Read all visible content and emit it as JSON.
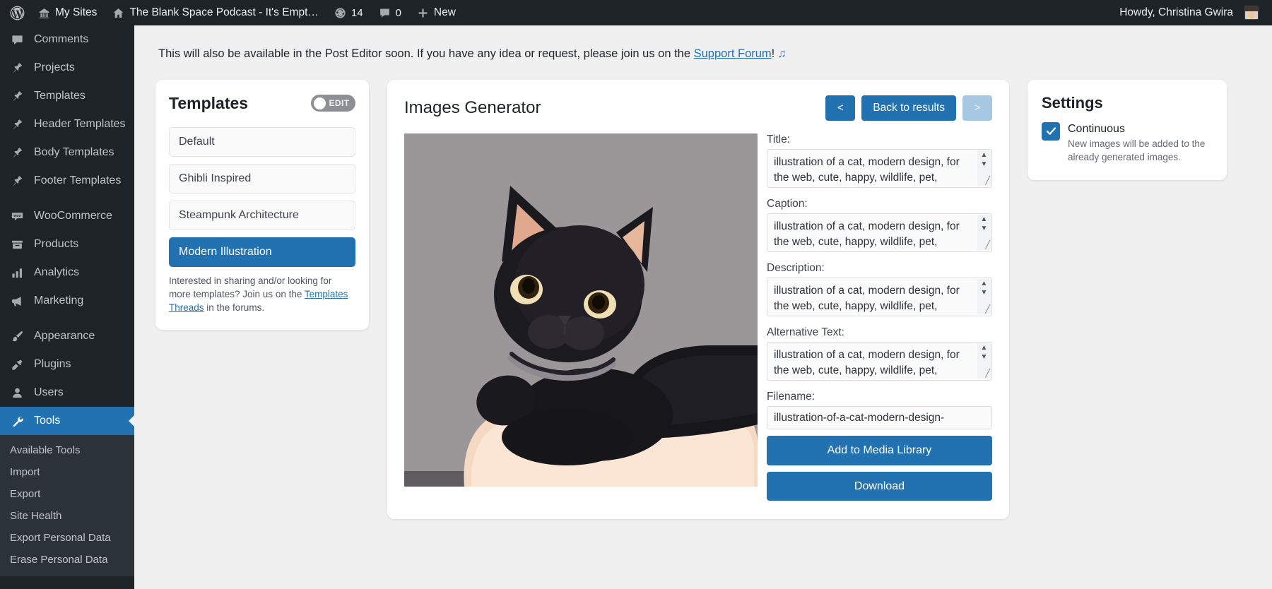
{
  "adminbar": {
    "logo_icon": "wordpress-logo-icon",
    "my_sites": {
      "label": "My Sites",
      "icon": "multisite-icon"
    },
    "site": {
      "label": "The Blank Space Podcast - It's Empt…",
      "icon": "home-icon"
    },
    "updates": {
      "count": "14",
      "icon": "updates-icon"
    },
    "comments": {
      "count": "0",
      "icon": "comment-bubble-icon"
    },
    "new": {
      "label": "New",
      "icon": "plus-icon"
    },
    "account": {
      "greeting": "Howdy, Christina Gwira",
      "avatar": "user-avatar"
    }
  },
  "sidebar": {
    "items": [
      {
        "label": "Comments",
        "icon": "comment-bubble-icon",
        "active": false
      },
      {
        "label": "Projects",
        "icon": "pin-icon",
        "active": false
      },
      {
        "label": "Templates",
        "icon": "pin-icon",
        "active": false
      },
      {
        "label": "Header Templates",
        "icon": "pin-icon",
        "active": false
      },
      {
        "label": "Body Templates",
        "icon": "pin-icon",
        "active": false
      },
      {
        "label": "Footer Templates",
        "icon": "pin-icon",
        "active": false
      },
      {
        "label": "WooCommerce",
        "icon": "woocommerce-icon",
        "active": false
      },
      {
        "label": "Products",
        "icon": "products-box-icon",
        "active": false
      },
      {
        "label": "Analytics",
        "icon": "bar-chart-icon",
        "active": false
      },
      {
        "label": "Marketing",
        "icon": "megaphone-icon",
        "active": false
      },
      {
        "label": "Appearance",
        "icon": "paintbrush-icon",
        "active": false
      },
      {
        "label": "Plugins",
        "icon": "plug-icon",
        "active": false
      },
      {
        "label": "Users",
        "icon": "user-icon",
        "active": false
      },
      {
        "label": "Tools",
        "icon": "wrench-icon",
        "active": true
      }
    ],
    "submenu": [
      {
        "label": "Available Tools"
      },
      {
        "label": "Import"
      },
      {
        "label": "Export"
      },
      {
        "label": "Site Health"
      },
      {
        "label": "Export Personal Data"
      },
      {
        "label": "Erase Personal Data"
      }
    ]
  },
  "notice": {
    "text_before": "This will also be available in the Post Editor soon. If you have any idea or request, please join us on the ",
    "link_label": "Support Forum",
    "text_after": "!",
    "emoji": "♫"
  },
  "templates_panel": {
    "title": "Templates",
    "toggle_label": "EDIT",
    "toggle_on": false,
    "items": [
      {
        "label": "Default",
        "selected": false
      },
      {
        "label": "Ghibli Inspired",
        "selected": false
      },
      {
        "label": "Steampunk Architecture",
        "selected": false
      },
      {
        "label": "Modern Illustration",
        "selected": true
      }
    ],
    "footer_before": "Interested in sharing and/or looking for more templates? Join us on the ",
    "footer_link": "Templates Threads",
    "footer_after": " in the forums."
  },
  "generator": {
    "title": "Images Generator",
    "prev_label": "<",
    "back_label": "Back to results",
    "next_label": ">",
    "next_disabled": true,
    "image_alt": "illustration of a black cat lying on a cream cushion, modern design",
    "fields": [
      {
        "label": "Title:",
        "type": "textarea",
        "value": "illustration of a cat, modern design, for the web, cute, happy, wildlife, pet, photorealistic"
      },
      {
        "label": "Caption:",
        "type": "textarea",
        "value": "illustration of a cat, modern design, for the web, cute, happy, wildlife, pet, photorealistic"
      },
      {
        "label": "Description:",
        "type": "textarea",
        "value": "illustration of a cat, modern design, for the web, cute, happy, wildlife, pet, photorealistic"
      },
      {
        "label": "Alternative Text:",
        "type": "textarea",
        "value": "illustration of a cat, modern design, for the web, cute, happy, wildlife, pet, photorealistic"
      },
      {
        "label": "Filename:",
        "type": "input",
        "value": "illustration-of-a-cat-modern-design-"
      }
    ],
    "add_to_media_label": "Add to Media Library",
    "download_label": "Download"
  },
  "settings_panel": {
    "title": "Settings",
    "option_label": "Continuous",
    "option_desc": "New images will be added to the already generated images.",
    "checked": true
  },
  "colors": {
    "admin_dark": "#1d2327",
    "admin_submenu": "#2c3338",
    "accent_blue": "#2271b1",
    "accent_disabled": "#a7c8e3",
    "page_bg": "#f0f0f1",
    "link_blue": "#2271b1",
    "image_bg": "#9b9698",
    "cat_body": "#17161a",
    "cushion": "#f8ddc8"
  }
}
